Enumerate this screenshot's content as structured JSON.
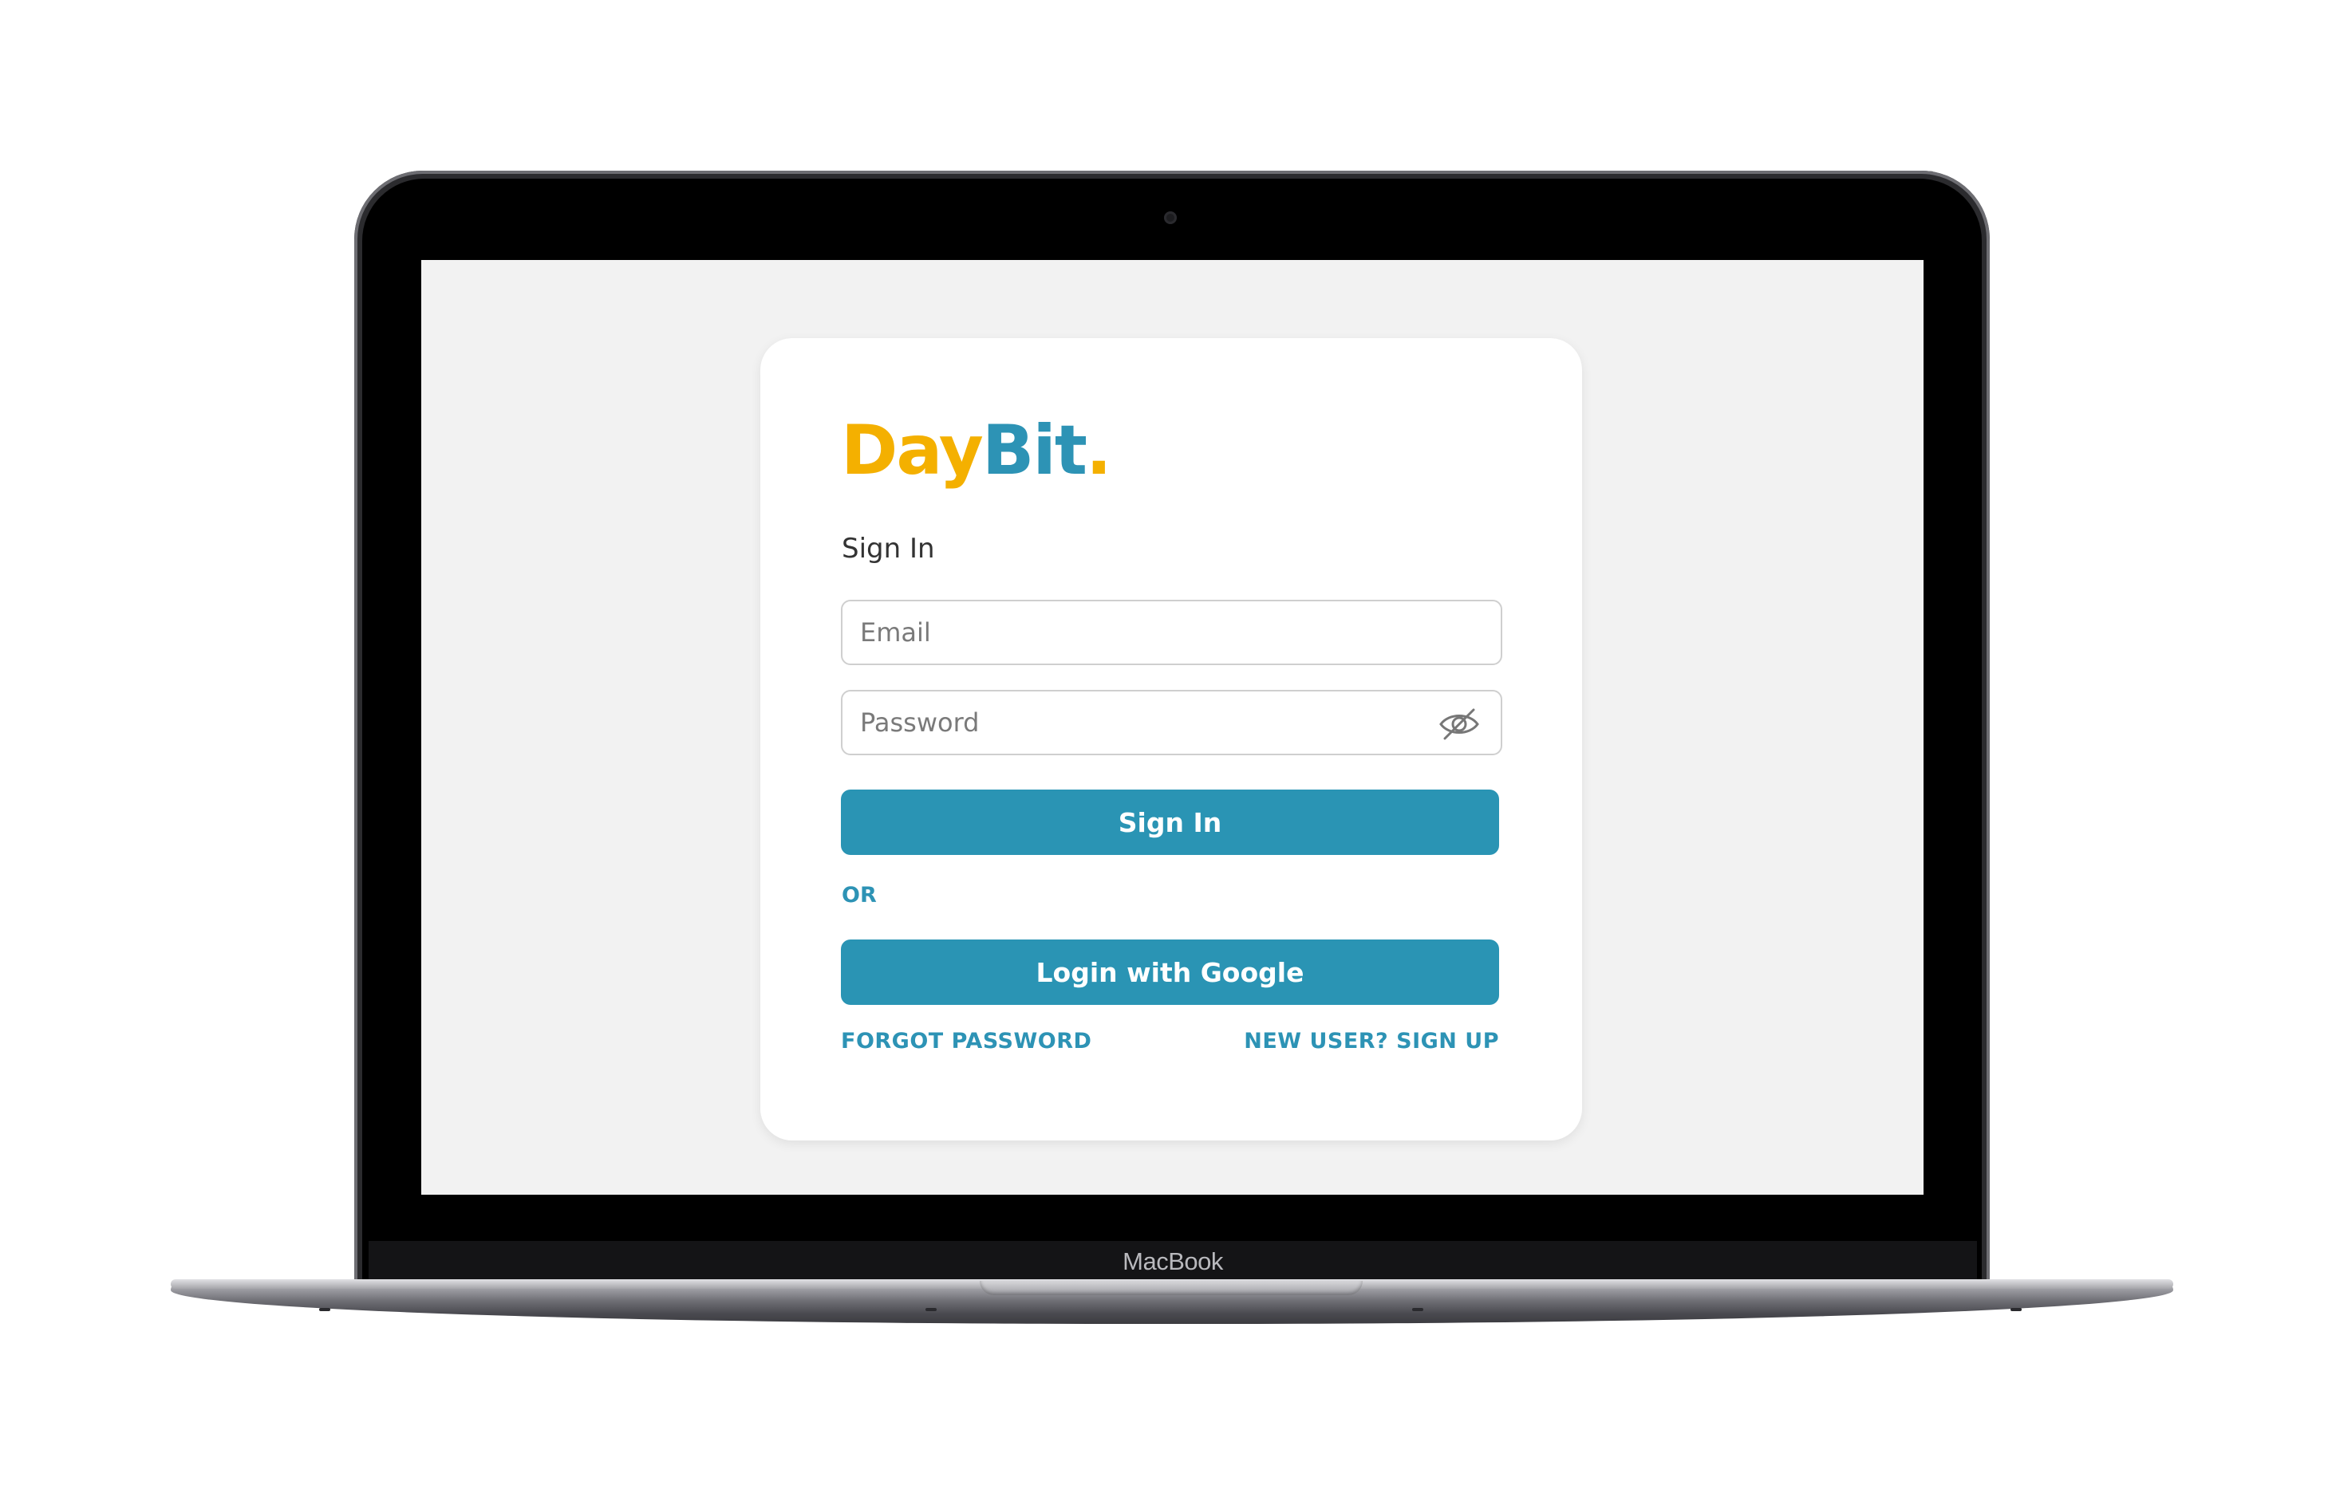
{
  "device": {
    "brand_label": "MacBook"
  },
  "login": {
    "logo": {
      "part1": "Day",
      "part2": "Bit",
      "part3": "."
    },
    "title": "Sign In",
    "email": {
      "placeholder": "Email",
      "value": ""
    },
    "password": {
      "placeholder": "Password",
      "value": "",
      "toggle_icon": "eye-off-icon"
    },
    "signin_button": "Sign In",
    "divider_text": "OR",
    "google_button": "Login with Google",
    "forgot_password_link": "FORGOT PASSWORD",
    "signup_link": "NEW USER? SIGN UP"
  },
  "colors": {
    "primary": "#2a94b4",
    "logo_yellow": "#f4b000",
    "logo_blue": "#2d93b5",
    "screen_background": "#f2f2f2",
    "card_background": "#ffffff"
  }
}
